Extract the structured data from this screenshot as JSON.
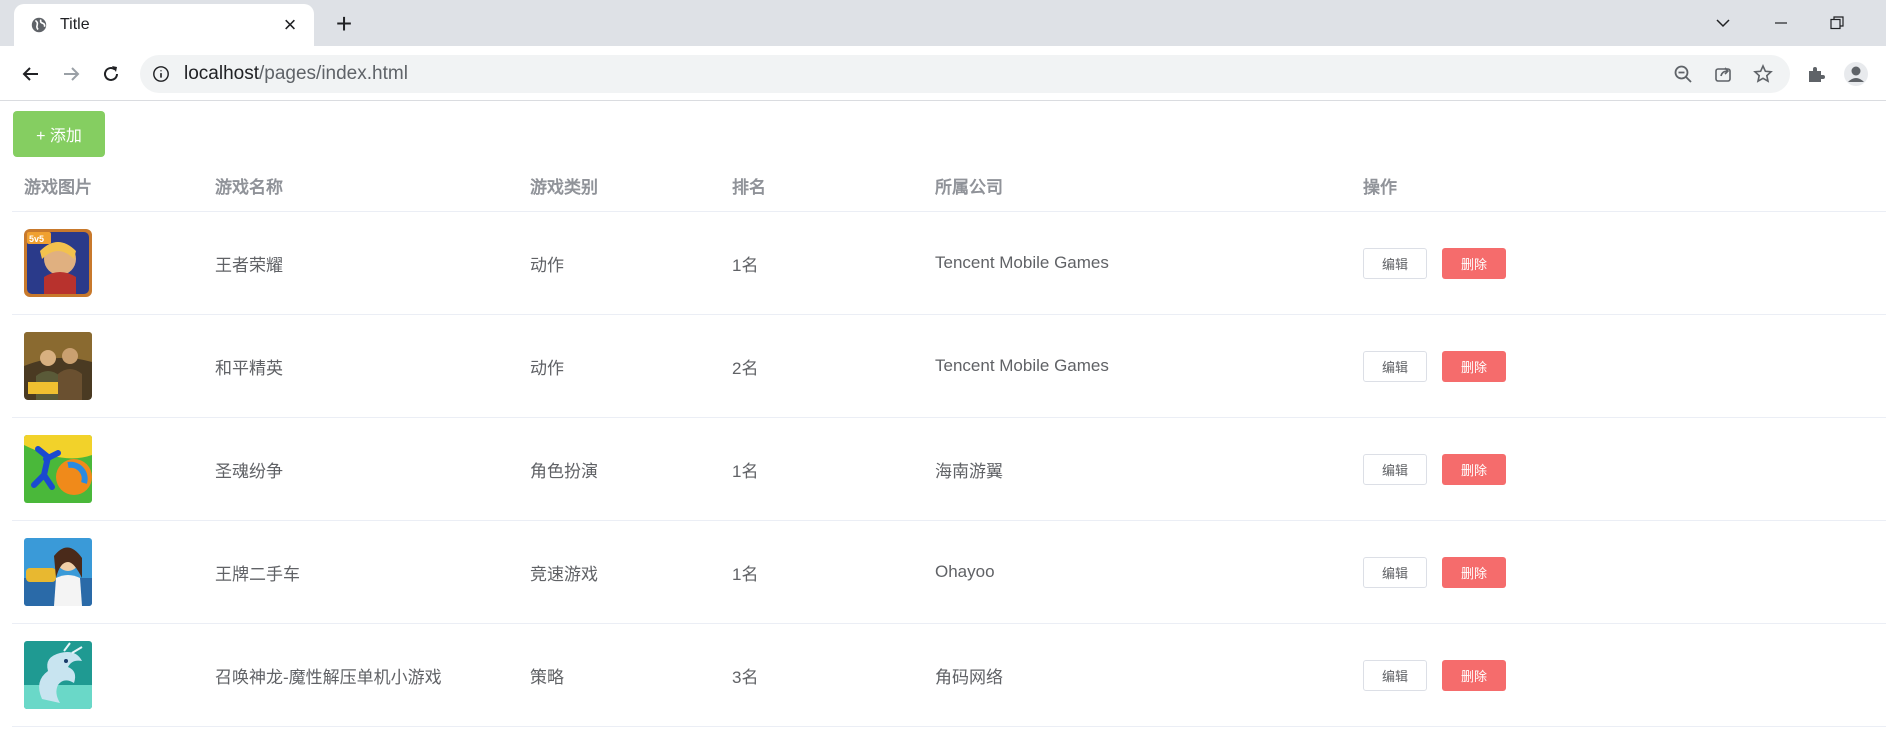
{
  "browser": {
    "tab_title": "Title",
    "url_host": "localhost",
    "url_path": "/pages/index.html"
  },
  "toolbar": {
    "add_label": "+ 添加"
  },
  "table": {
    "headers": {
      "image": "游戏图片",
      "name": "游戏名称",
      "category": "游戏类别",
      "rank": "排名",
      "company": "所属公司",
      "actions": "操作"
    },
    "edit_label": "编辑",
    "delete_label": "删除",
    "rows": [
      {
        "name": "王者荣耀",
        "category": "动作",
        "rank": "1名",
        "company": "Tencent Mobile Games"
      },
      {
        "name": "和平精英",
        "category": "动作",
        "rank": "2名",
        "company": "Tencent Mobile Games"
      },
      {
        "name": "圣魂纷争",
        "category": "角色扮演",
        "rank": "1名",
        "company": "海南游翼"
      },
      {
        "name": "王牌二手车",
        "category": "竞速游戏",
        "rank": "1名",
        "company": "Ohayoo"
      },
      {
        "name": "召唤神龙-魔性解压单机小游戏",
        "category": "策略",
        "rank": "3名",
        "company": "角码网络"
      }
    ]
  },
  "colors": {
    "add_button": "#85ce61",
    "delete_button": "#f56c6c",
    "header_text": "#909399",
    "cell_text": "#606266"
  }
}
